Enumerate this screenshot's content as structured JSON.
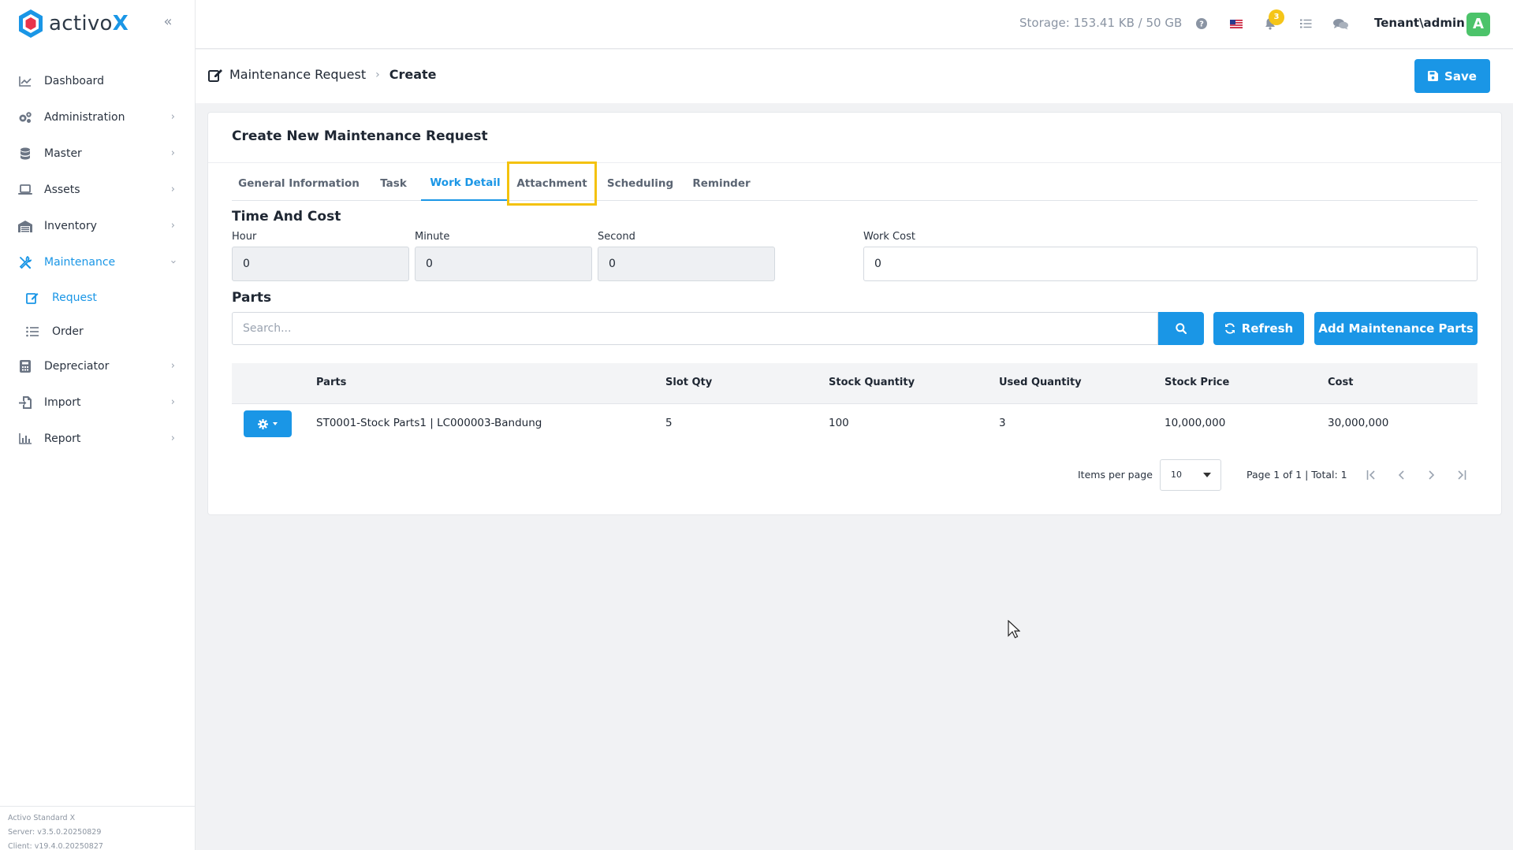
{
  "brand": {
    "name_part1": "activo",
    "name_part2": "X"
  },
  "sidebar": {
    "items": [
      {
        "label": "Dashboard",
        "icon": "chart-line-icon"
      },
      {
        "label": "Administration",
        "icon": "cogs-icon"
      },
      {
        "label": "Master",
        "icon": "database-icon"
      },
      {
        "label": "Assets",
        "icon": "laptop-icon"
      },
      {
        "label": "Inventory",
        "icon": "warehouse-icon"
      },
      {
        "label": "Maintenance",
        "icon": "tools-icon"
      },
      {
        "label": "Depreciator",
        "icon": "calculator-icon"
      },
      {
        "label": "Import",
        "icon": "file-import-icon"
      },
      {
        "label": "Report",
        "icon": "chart-bar-icon"
      }
    ],
    "maintenance_sub": [
      {
        "label": "Request"
      },
      {
        "label": "Order"
      }
    ],
    "version": {
      "product": "Activo Standard X",
      "server": "Server: v3.5.0.20250829",
      "client": "Client: v19.4.0.20250827"
    }
  },
  "topbar": {
    "storage": "Storage: 153.41 KB / 50 GB",
    "notification_count": "3",
    "user": "Tenant\\admin",
    "avatar_letter": "A"
  },
  "breadcrumb": {
    "parent": "Maintenance Request",
    "current": "Create"
  },
  "actions": {
    "save": "Save"
  },
  "card": {
    "title": "Create New Maintenance Request",
    "tabs": [
      "General Information",
      "Task",
      "Work Detail",
      "Attachment",
      "Scheduling",
      "Reminder"
    ],
    "time_cost": {
      "title": "Time And Cost",
      "hour_label": "Hour",
      "hour_value": "0",
      "minute_label": "Minute",
      "minute_value": "0",
      "second_label": "Second",
      "second_value": "0",
      "work_cost_label": "Work Cost",
      "work_cost_value": "0"
    },
    "parts": {
      "title": "Parts",
      "search_placeholder": "Search...",
      "refresh": "Refresh",
      "add": "Add Maintenance Parts",
      "columns": [
        "Parts",
        "Slot Qty",
        "Stock Quantity",
        "Used Quantity",
        "Stock Price",
        "Cost"
      ],
      "rows": [
        {
          "parts": "ST0001-Stock Parts1 | LC000003-Bandung",
          "slot_qty": "5",
          "stock_quantity": "100",
          "used_quantity": "3",
          "stock_price": "10,000,000",
          "cost": "30,000,000"
        }
      ],
      "pager": {
        "items_per_page_label": "Items per page",
        "items_per_page": "10",
        "info": "Page 1 of 1 | Total: 1"
      }
    }
  },
  "colors": {
    "accent": "#1a96e6",
    "highlight": "#f4c20d",
    "avatar": "#4cc36a",
    "badge": "#f5c518"
  }
}
